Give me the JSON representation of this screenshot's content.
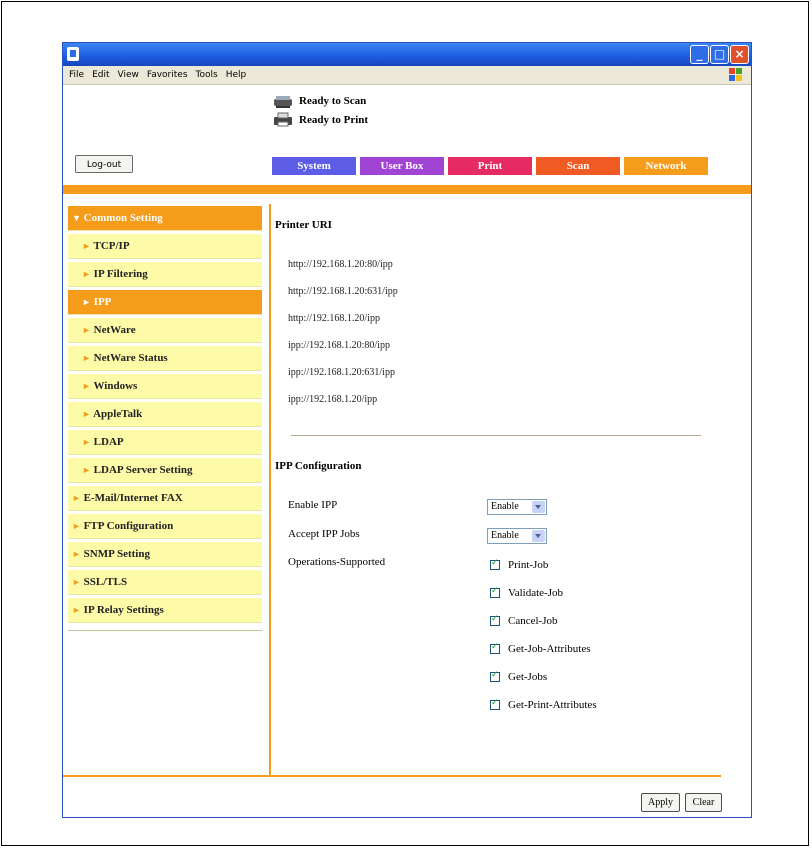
{
  "menu": [
    "File",
    "Edit",
    "View",
    "Favorites",
    "Tools",
    "Help"
  ],
  "status": {
    "scan": "Ready to Scan",
    "print": "Ready to Print"
  },
  "logout_label": "Log-out",
  "tabs": [
    {
      "label": "System",
      "color": "#5c5ce6"
    },
    {
      "label": "User Box",
      "color": "#a144d4"
    },
    {
      "label": "Print",
      "color": "#e62b62"
    },
    {
      "label": "Scan",
      "color": "#f05a23"
    },
    {
      "label": "Network",
      "color": "#f59c1a"
    }
  ],
  "sidebar": [
    {
      "label": "Common Setting",
      "arrow": "▼"
    },
    {
      "label": "TCP/IP",
      "arrow": "►"
    },
    {
      "label": "IP Filtering",
      "arrow": "►"
    },
    {
      "label": "IPP",
      "arrow": "►"
    },
    {
      "label": "NetWare",
      "arrow": "►"
    },
    {
      "label": "NetWare Status",
      "arrow": "►"
    },
    {
      "label": "Windows",
      "arrow": "►"
    },
    {
      "label": "AppleTalk",
      "arrow": "►"
    },
    {
      "label": "LDAP",
      "arrow": "►"
    },
    {
      "label": "LDAP Server Setting",
      "arrow": "►"
    },
    {
      "label": "E-Mail/Internet FAX",
      "arrow": "►"
    },
    {
      "label": "FTP Configuration",
      "arrow": "►"
    },
    {
      "label": "SNMP Setting",
      "arrow": "►"
    },
    {
      "label": "SSL/TLS",
      "arrow": "►"
    },
    {
      "label": "IP Relay Settings",
      "arrow": "►"
    }
  ],
  "printer_uri": {
    "title": "Printer URI",
    "uris": [
      "http://192.168.1.20:80/ipp",
      "http://192.168.1.20:631/ipp",
      "http://192.168.1.20/ipp",
      "ipp://192.168.1.20:80/ipp",
      "ipp://192.168.1.20:631/ipp",
      "ipp://192.168.1.20/ipp"
    ]
  },
  "ipp_config": {
    "title": "IPP Configuration",
    "enable_ipp": {
      "label": "Enable IPP",
      "value": "Enable"
    },
    "accept_jobs": {
      "label": "Accept IPP Jobs",
      "value": "Enable"
    },
    "ops_label": "Operations-Supported",
    "operations": [
      {
        "label": "Print-Job",
        "checked": true
      },
      {
        "label": "Validate-Job",
        "checked": true
      },
      {
        "label": "Cancel-Job",
        "checked": true
      },
      {
        "label": "Get-Job-Attributes",
        "checked": true
      },
      {
        "label": "Get-Jobs",
        "checked": true
      },
      {
        "label": "Get-Print-Attributes",
        "checked": true
      }
    ]
  },
  "buttons": {
    "apply": "Apply",
    "clear": "Clear"
  }
}
